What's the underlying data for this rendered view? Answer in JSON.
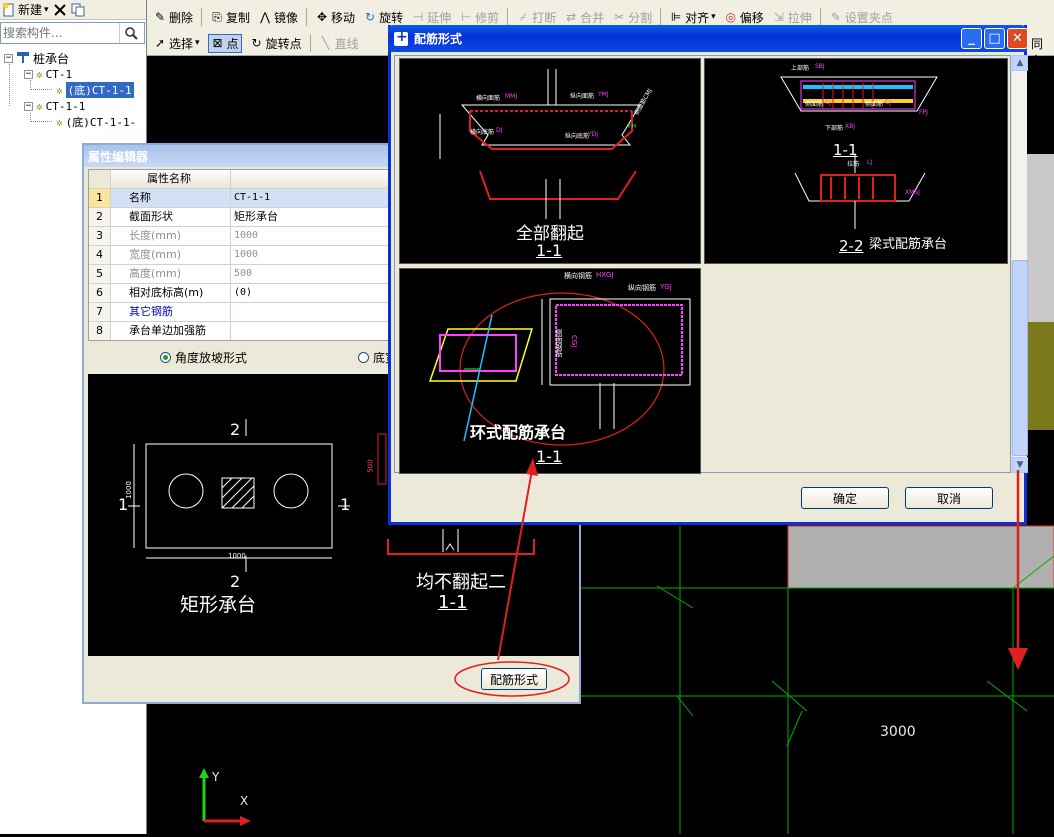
{
  "left_panel": {
    "toolbar": {
      "new_label": "新建",
      "new_arrow": "▾"
    },
    "search_placeholder": "搜索构件...",
    "tree": {
      "root": "桩承台",
      "group1": "CT-1",
      "group1_child": "(底)CT-1-1",
      "group2": "CT-1-1",
      "group2_child": "(底)CT-1-1-"
    }
  },
  "main_toolbar": {
    "row1": {
      "delete": "删除",
      "copy": "复制",
      "mirror": "镜像",
      "move": "移动",
      "rotate": "旋转",
      "extend": "延伸",
      "trim": "修剪",
      "break": "打断",
      "merge": "合并",
      "split": "分割",
      "align": "对齐",
      "offset": "偏移",
      "stretch": "拉伸",
      "grip": "设置夹点"
    },
    "row2": {
      "select": "选择",
      "point": "点",
      "rotate_point": "旋转点",
      "line": "直线",
      "same_name": "同名"
    }
  },
  "prop_editor": {
    "title": "属性编辑器",
    "columns": [
      "属性名称",
      "属性值"
    ],
    "rows": [
      {
        "num": "1",
        "name": "名称",
        "value": "CT-1-1"
      },
      {
        "num": "2",
        "name": "截面形状",
        "value": "矩形承台"
      },
      {
        "num": "3",
        "name": "长度(mm)",
        "value": "1000"
      },
      {
        "num": "4",
        "name": "宽度(mm)",
        "value": "1000"
      },
      {
        "num": "5",
        "name": "高度(mm)",
        "value": "500"
      },
      {
        "num": "6",
        "name": "相对底标高(m)",
        "value": "(0)"
      },
      {
        "num": "7",
        "name": "其它钢筋",
        "value": ""
      },
      {
        "num": "8",
        "name": "承台单边加强筋",
        "value": ""
      }
    ],
    "radio_angle": "角度放坡形式",
    "radio_bottom": "底宽",
    "preview": {
      "label_2_top": "2",
      "label_2_bottom": "2",
      "label_1_left": "1",
      "label_1_right": "1",
      "dim_1000_h": "1000",
      "dim_1000_v": "1000",
      "dim_500": "500",
      "caption_rect": "矩形承台",
      "caption_none": "均不翻起二",
      "caption_section": "1-1"
    },
    "rebar_button": "配筋形式"
  },
  "rebar_dialog": {
    "title": "配筋形式",
    "options": [
      {
        "caption": "全部翻起",
        "section": "1-1",
        "tags": [
          "横向面筋",
          "MMJ",
          "纵向面筋",
          "YMJ",
          "侧面筋CMJ",
          "横向底筋",
          "DJ",
          "纵向底筋",
          "YDJ",
          "FH"
        ]
      },
      {
        "caption": "梁式配筋承台",
        "section_a": "1-1",
        "section_b": "2-2",
        "tags": [
          "上部筋",
          "SBJ",
          "侧面筋",
          "CJ",
          "侧面筋",
          "CJ",
          "下部筋",
          "XBJ",
          "FPJ",
          "拉筋",
          "LJ",
          "XMSJ"
        ]
      },
      {
        "caption": "环式配筋承台",
        "section": "1-1",
        "tags": [
          "横向钢筋",
          "HXGJ",
          "纵向钢筋",
          "YGJ",
          "侧面钢筋",
          "CGJ"
        ]
      }
    ],
    "ok": "确定",
    "cancel": "取消"
  },
  "canvas": {
    "dim_label": "3000",
    "axis_y": "Y",
    "axis_x": "X"
  },
  "colors": {
    "dialog_blue": "#0831d9",
    "annotation_red": "#e02020",
    "grid_green": "#00b000",
    "xp_face": "#ece9d8"
  }
}
